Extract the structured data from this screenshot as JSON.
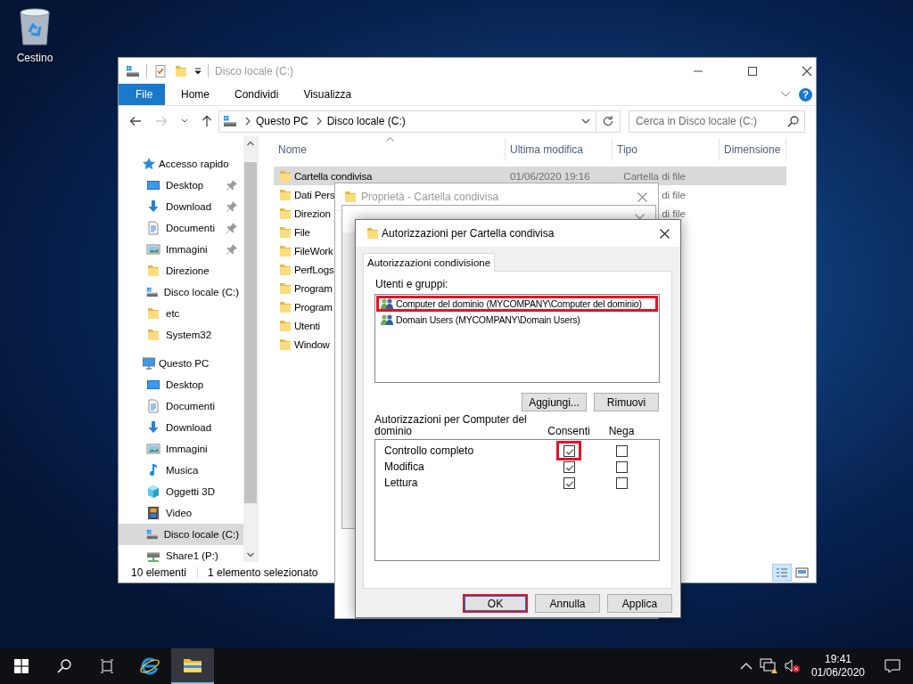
{
  "desktop_icons": [
    {
      "label": "Cestino"
    }
  ],
  "explorer": {
    "title": "Disco locale (C:)",
    "ribbon_tabs": [
      {
        "label": "File",
        "kind": "file"
      },
      {
        "label": "Home",
        "kind": "tab"
      },
      {
        "label": "Condividi",
        "kind": "tab"
      },
      {
        "label": "Visualizza",
        "kind": "tab"
      }
    ],
    "help": "?",
    "breadcrumb": [
      "Questo PC",
      "Disco locale (C:)"
    ],
    "search": {
      "placeholder": "Cerca in Disco locale (C:)"
    },
    "sidebar": [
      {
        "label": "Accesso rapido",
        "kind": "star",
        "selected": false,
        "children": [
          {
            "label": "Desktop",
            "kind": "desktop",
            "pinned": true,
            "selected": false
          },
          {
            "label": "Download",
            "kind": "download",
            "pinned": true,
            "selected": false
          },
          {
            "label": "Documenti",
            "kind": "documents",
            "pinned": true,
            "selected": false
          },
          {
            "label": "Immagini",
            "kind": "pictures",
            "pinned": true,
            "selected": false
          },
          {
            "label": "Direzione",
            "kind": "folder",
            "pinned": false,
            "selected": false
          },
          {
            "label": "Disco locale (C:)",
            "kind": "drive",
            "pinned": false,
            "selected": false
          },
          {
            "label": "etc",
            "kind": "folder",
            "pinned": false,
            "selected": false
          },
          {
            "label": "System32",
            "kind": "folder",
            "pinned": false,
            "selected": false
          }
        ]
      },
      {
        "label": "Questo PC",
        "kind": "pc",
        "selected": false,
        "children": [
          {
            "label": "Desktop",
            "kind": "desktop",
            "pinned": false,
            "selected": false
          },
          {
            "label": "Documenti",
            "kind": "documents",
            "pinned": false,
            "selected": false
          },
          {
            "label": "Download",
            "kind": "download",
            "pinned": false,
            "selected": false
          },
          {
            "label": "Immagini",
            "kind": "pictures",
            "pinned": false,
            "selected": false
          },
          {
            "label": "Musica",
            "kind": "music",
            "pinned": false,
            "selected": false
          },
          {
            "label": "Oggetti 3D",
            "kind": "objects3d",
            "pinned": false,
            "selected": false
          },
          {
            "label": "Video",
            "kind": "video",
            "pinned": false,
            "selected": false
          },
          {
            "label": "Disco locale (C:)",
            "kind": "drive",
            "pinned": false,
            "selected": true
          },
          {
            "label": "Share1 (P:)",
            "kind": "netdrive",
            "pinned": false,
            "selected": false
          }
        ]
      }
    ],
    "columns": [
      {
        "label": "Nome",
        "sorted": true
      },
      {
        "label": "Ultima modifica",
        "sorted": false
      },
      {
        "label": "Tipo",
        "sorted": false
      },
      {
        "label": "Dimensione",
        "sorted": false
      }
    ],
    "rows": [
      {
        "name": "Cartella condivisa",
        "modified": "01/06/2020 19:16",
        "type": "Cartella di file",
        "selected": true
      },
      {
        "name": "Dati Pers",
        "type": "di file",
        "selected": false
      },
      {
        "name": "Direzion",
        "type": "di file",
        "selected": false
      },
      {
        "name": "File",
        "selected": false
      },
      {
        "name": "FileWork",
        "selected": false
      },
      {
        "name": "PerfLogs",
        "selected": false
      },
      {
        "name": "Program",
        "selected": false
      },
      {
        "name": "Program",
        "selected": false
      },
      {
        "name": "Utenti",
        "selected": false
      },
      {
        "name": "Window",
        "selected": false
      }
    ],
    "status": [
      "10 elementi",
      "1 elemento selezionato"
    ],
    "views": [
      {
        "kind": "details",
        "selected": true
      },
      {
        "kind": "tiles",
        "selected": false
      }
    ]
  },
  "dialogs": {
    "properties": {
      "title": "Proprietà - Cartella condivisa"
    },
    "permissions": {
      "title": "Autorizzazioni per Cartella condivisa",
      "tabs": [
        {
          "label": "Autorizzazioni condivisione",
          "selected": true
        }
      ],
      "users_label": "Utenti e gruppi:",
      "users": [
        {
          "name": "Computer del dominio (MYCOMPANY\\Computer del dominio)",
          "highlighted": true
        },
        {
          "name": "Domain Users (MYCOMPANY\\Domain Users)",
          "highlighted": false
        }
      ],
      "user_buttons": [
        "Aggiungi...",
        "Rimuovi"
      ],
      "permissions_label": "Autorizzazioni per Computer del dominio",
      "allow_label": "Consenti",
      "deny_label": "Nega",
      "permissions": [
        {
          "name": "Controllo completo",
          "allow": true,
          "deny": false,
          "highlighted": true
        },
        {
          "name": "Modifica",
          "allow": true,
          "deny": false,
          "highlighted": false
        },
        {
          "name": "Lettura",
          "allow": true,
          "deny": false,
          "highlighted": false
        }
      ],
      "buttons": [
        {
          "label": "OK",
          "default": true,
          "highlighted": true
        },
        {
          "label": "Annulla",
          "default": false,
          "highlighted": false
        },
        {
          "label": "Applica",
          "default": false,
          "highlighted": false
        }
      ]
    }
  },
  "taskbar": {
    "apps": [
      {
        "kind": "browser",
        "active": false
      },
      {
        "kind": "explorer",
        "active": true
      }
    ],
    "time": "19:41",
    "date": "01/06/2020"
  }
}
